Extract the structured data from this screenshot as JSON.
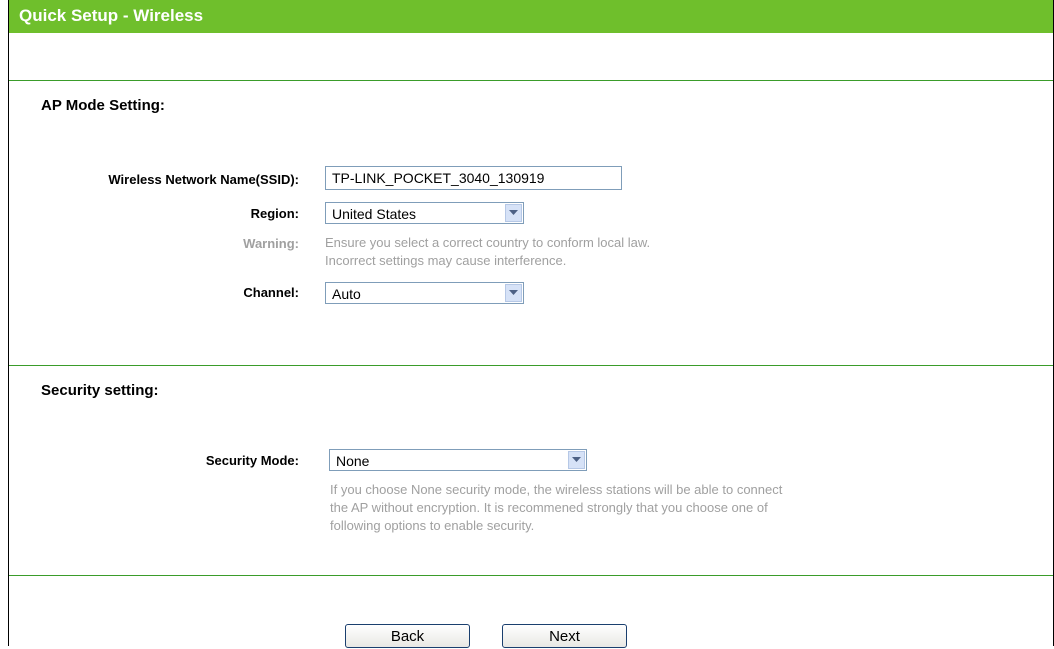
{
  "header": {
    "title": "Quick Setup - Wireless"
  },
  "ap_section": {
    "title": "AP Mode Setting:",
    "ssid_label": "Wireless Network Name(SSID):",
    "ssid_value": "TP-LINK_POCKET_3040_130919",
    "region_label": "Region:",
    "region_value": "United States",
    "warning_label": "Warning:",
    "warning_line1": "Ensure you select a correct country to conform local law.",
    "warning_line2": "Incorrect settings may cause interference.",
    "channel_label": "Channel:",
    "channel_value": "Auto"
  },
  "security_section": {
    "title": "Security setting:",
    "mode_label": "Security Mode:",
    "mode_value": "None",
    "note_line1": "If you choose None security mode, the wireless stations will be able to connect",
    "note_line2": "the AP without encryption. It is recommened strongly that you choose one of",
    "note_line3": "following options to enable security."
  },
  "footer": {
    "back_label": "Back",
    "next_label": "Next"
  },
  "colors": {
    "header_green": "#6fbf2c",
    "divider_green": "#3a9c2a",
    "hint_gray": "#a0a0a0"
  }
}
